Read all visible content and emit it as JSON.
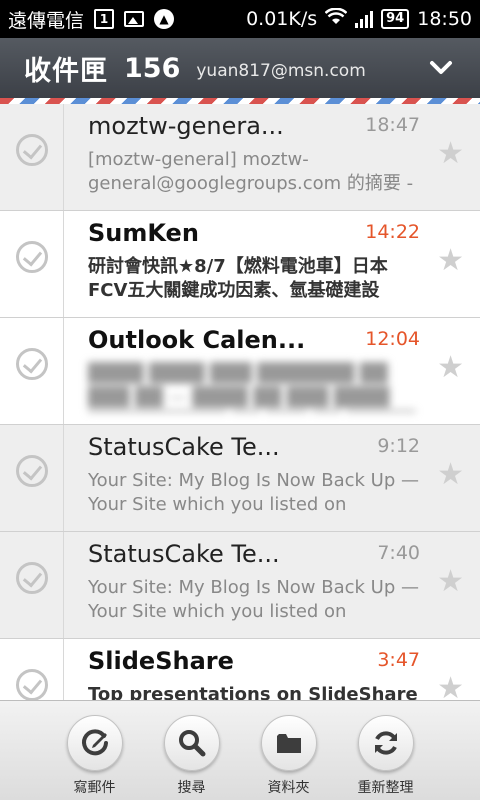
{
  "status_bar": {
    "carrier": "遠傳電信",
    "calendar_day": "1",
    "net_speed": "0.01K/s",
    "battery": "94",
    "time": "18:50"
  },
  "header": {
    "title": "收件匣",
    "count": "156",
    "account": "yuan817@msn.com"
  },
  "messages": [
    {
      "sender": "moztw-genera...",
      "time": "18:47",
      "snippet": "[moztw-general] moztw-general@googlegroups.com 的摘要 -",
      "read": true,
      "time_color": "#999999"
    },
    {
      "sender": "SumKen",
      "time": "14:22",
      "snippet": "研討會快訊★8/7【燃料電池車】日本FCV五大關鍵成功因素、氫基礎建設",
      "read": false,
      "time_color": "#e5552a"
    },
    {
      "sender": "Outlook Calen...",
      "time": "12:04",
      "snippet": "",
      "read": false,
      "time_color": "#e5552a"
    },
    {
      "sender": "StatusCake Te...",
      "time": "9:12",
      "snippet": "Your Site: My Blog Is Now Back Up — Your Site which you listed on",
      "read": true,
      "time_color": "#999999"
    },
    {
      "sender": "StatusCake Te...",
      "time": "7:40",
      "snippet": "Your Site: My Blog Is Now Back Up — Your Site which you listed on",
      "read": true,
      "time_color": "#999999"
    },
    {
      "sender": "SlideShare",
      "time": "3:47",
      "snippet": "Top presentations on SlideShare this",
      "read": false,
      "time_color": "#e5552a"
    }
  ],
  "toolbar": {
    "compose_label": "寫郵件",
    "search_label": "搜尋",
    "folders_label": "資料夾",
    "refresh_label": "重新整理"
  },
  "icons": {
    "compose": "pen-icon",
    "search": "search-icon",
    "folders": "folder-icon",
    "refresh": "refresh-icon",
    "star": "star-icon",
    "check": "check-circle-icon"
  },
  "colors": {
    "header_bg": "#45494f",
    "unread_time": "#e5552a",
    "read_row_bg": "#eeeeee"
  }
}
